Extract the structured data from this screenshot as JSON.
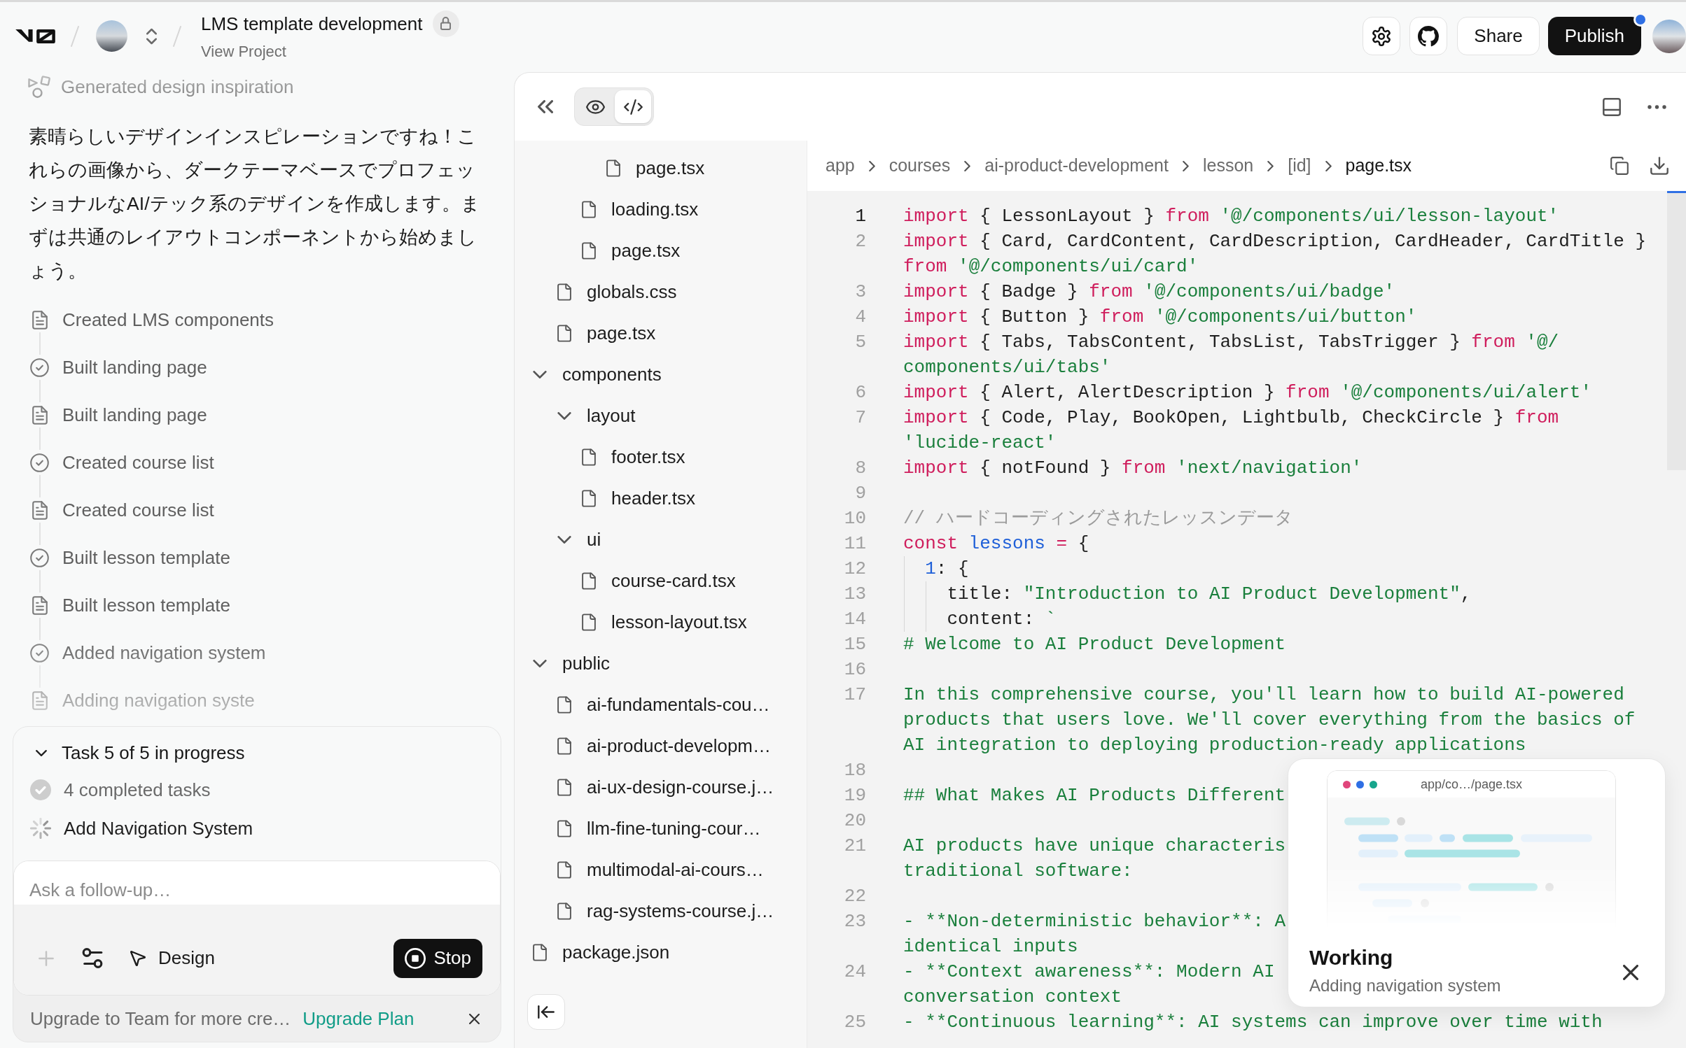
{
  "header": {
    "title": "LMS template development",
    "subtitle": "View Project",
    "buttons": [
      {
        "kind": "secondary",
        "label": "Share",
        "notification": false
      },
      {
        "kind": "primary",
        "label": "Publish",
        "notification": true
      }
    ]
  },
  "chat": {
    "items": [
      {
        "kind": "design",
        "label": "Generated design inspiration"
      },
      {
        "kind": "message",
        "text": "素晴らしいデザインインスピレーションですね！これらの画像から、ダークテーマベースでプロフェッショナルなAI/テック系のデザインを作成します。まずは共通のレイアウトコンポーネントから始めましょう。"
      },
      {
        "kind": "file",
        "label": "Created LMS components"
      },
      {
        "kind": "done",
        "label": "Built landing page"
      },
      {
        "kind": "file",
        "label": "Built landing page"
      },
      {
        "kind": "done",
        "label": "Created course list"
      },
      {
        "kind": "file",
        "label": "Created course list"
      },
      {
        "kind": "done",
        "label": "Built lesson template"
      },
      {
        "kind": "file",
        "label": "Built lesson template"
      },
      {
        "kind": "done",
        "label": "Added navigation system"
      },
      {
        "kind": "file",
        "label": "Adding navigation syste"
      }
    ]
  },
  "task_panel": {
    "title": "Task 5 of 5 in progress",
    "expanded": true,
    "items": [
      {
        "kind": "done",
        "label": "4 completed tasks"
      },
      {
        "kind": "running",
        "label": "Add Navigation System"
      }
    ]
  },
  "composer": {
    "placeholder": "Ask a follow-up…",
    "attach_disabled": true,
    "mode": "Design",
    "stop": "Stop"
  },
  "upgrade_banner": {
    "text": "Upgrade to Team for more cre…",
    "link": "Upgrade Plan"
  },
  "workspace": {
    "view_toggle": [
      {
        "kind": "preview",
        "selected": false
      },
      {
        "kind": "code",
        "selected": true
      }
    ],
    "file_tree": [
      {
        "children": [
          {
            "children": [
              {
                "children": [
                  {
                    "kind": "file",
                    "label": "page.tsx"
                  }
                ]
              },
              {
                "kind": "file",
                "label": "loading.tsx"
              },
              {
                "kind": "file",
                "label": "page.tsx"
              }
            ]
          },
          {
            "kind": "file",
            "label": "globals.css"
          },
          {
            "kind": "file",
            "label": "page.tsx"
          }
        ]
      },
      {
        "kind": "folder",
        "label": "components",
        "expanded": true,
        "children": [
          {
            "kind": "folder",
            "label": "layout",
            "expanded": true,
            "children": [
              {
                "kind": "file",
                "label": "footer.tsx"
              },
              {
                "kind": "file",
                "label": "header.tsx"
              }
            ]
          },
          {
            "kind": "folder",
            "label": "ui",
            "expanded": true,
            "children": [
              {
                "kind": "file",
                "label": "course-card.tsx"
              },
              {
                "kind": "file",
                "label": "lesson-layout.tsx"
              }
            ]
          }
        ]
      },
      {
        "kind": "folder",
        "label": "public",
        "expanded": true,
        "children": [
          {
            "kind": "file",
            "label": "ai-fundamentals-cou…"
          },
          {
            "kind": "file",
            "label": "ai-product-developm…"
          },
          {
            "kind": "file",
            "label": "ai-ux-design-course.j…"
          },
          {
            "kind": "file",
            "label": "llm-fine-tuning-cour…"
          },
          {
            "kind": "file",
            "label": "multimodal-ai-cours…"
          },
          {
            "kind": "file",
            "label": "rag-systems-course.j…"
          }
        ]
      },
      {
        "kind": "file",
        "label": "package.json"
      }
    ],
    "breadcrumb": [
      {
        "label": "app",
        "current": false
      },
      {
        "label": "courses",
        "current": false
      },
      {
        "label": "ai-product-development",
        "current": false
      },
      {
        "label": "lesson",
        "current": false
      },
      {
        "label": "[id]",
        "current": false
      },
      {
        "label": "page.tsx",
        "current": true
      }
    ],
    "code_lines": [
      {
        "number": "1",
        "active": true,
        "rows": [
          [
            {
              "kind": "keyword",
              "text": "import"
            },
            {
              "kind": "plain",
              "text": " { LessonLayout } "
            },
            {
              "kind": "keyword",
              "text": "from"
            },
            {
              "kind": "string",
              "text": " '@/components/ui/lesson-layout'"
            }
          ]
        ]
      },
      {
        "number": "2",
        "active": false,
        "rows": [
          [
            {
              "kind": "keyword",
              "text": "import"
            },
            {
              "kind": "plain",
              "text": " { Card, CardContent, CardDescription, CardHeader, CardTitle }"
            }
          ],
          [
            {
              "kind": "keyword",
              "text": "from"
            },
            {
              "kind": "string",
              "text": " '@/components/ui/card'"
            }
          ]
        ]
      },
      {
        "number": "3",
        "active": false,
        "rows": [
          [
            {
              "kind": "keyword",
              "text": "import"
            },
            {
              "kind": "plain",
              "text": " { Badge } "
            },
            {
              "kind": "keyword",
              "text": "from"
            },
            {
              "kind": "string",
              "text": " '@/components/ui/badge'"
            }
          ]
        ]
      },
      {
        "number": "4",
        "active": false,
        "rows": [
          [
            {
              "kind": "keyword",
              "text": "import"
            },
            {
              "kind": "plain",
              "text": " { Button } "
            },
            {
              "kind": "keyword",
              "text": "from"
            },
            {
              "kind": "string",
              "text": " '@/components/ui/button'"
            }
          ]
        ]
      },
      {
        "number": "5",
        "active": false,
        "rows": [
          [
            {
              "kind": "keyword",
              "text": "import"
            },
            {
              "kind": "plain",
              "text": " { Tabs, TabsContent, TabsList, TabsTrigger } "
            },
            {
              "kind": "keyword",
              "text": "from"
            },
            {
              "kind": "string",
              "text": " '@/"
            }
          ],
          [
            {
              "kind": "string",
              "text": "components/ui/tabs'"
            }
          ]
        ]
      },
      {
        "number": "6",
        "active": false,
        "rows": [
          [
            {
              "kind": "keyword",
              "text": "import"
            },
            {
              "kind": "plain",
              "text": " { Alert, AlertDescription } "
            },
            {
              "kind": "keyword",
              "text": "from"
            },
            {
              "kind": "string",
              "text": " '@/components/ui/alert'"
            }
          ]
        ]
      },
      {
        "number": "7",
        "active": false,
        "rows": [
          [
            {
              "kind": "keyword",
              "text": "import"
            },
            {
              "kind": "plain",
              "text": " { Code, Play, BookOpen, Lightbulb, CheckCircle } "
            },
            {
              "kind": "keyword",
              "text": "from"
            }
          ],
          [
            {
              "kind": "string",
              "text": "'lucide-react'"
            }
          ]
        ]
      },
      {
        "number": "8",
        "active": false,
        "rows": [
          [
            {
              "kind": "keyword",
              "text": "import"
            },
            {
              "kind": "plain",
              "text": " { notFound } "
            },
            {
              "kind": "keyword",
              "text": "from"
            },
            {
              "kind": "string",
              "text": " 'next/navigation'"
            }
          ]
        ]
      },
      {
        "number": "9",
        "active": false
      },
      {
        "number": "10",
        "active": false,
        "rows": [
          [
            {
              "kind": "comment",
              "text": "// ハードコーディングされたレッスンデータ"
            }
          ]
        ]
      },
      {
        "number": "11",
        "active": false,
        "rows": [
          [
            {
              "kind": "keyword",
              "text": "const"
            },
            {
              "kind": "variable",
              "text": " lessons"
            },
            {
              "kind": "keyword",
              "text": " ="
            },
            {
              "kind": "plain",
              "text": " {"
            }
          ]
        ]
      },
      {
        "number": "12",
        "active": false,
        "rows": [
          [
            {
              "kind": "plain",
              "text": "  "
            },
            {
              "kind": "number",
              "text": "1"
            },
            {
              "kind": "plain",
              "text": ": {"
            }
          ]
        ]
      },
      {
        "number": "13",
        "active": false,
        "rows": [
          [
            {
              "kind": "plain",
              "text": "    title: "
            },
            {
              "kind": "string",
              "text": "\"Introduction to AI Product Development\""
            },
            {
              "kind": "plain",
              "text": ","
            }
          ]
        ]
      },
      {
        "number": "14",
        "active": false,
        "rows": [
          [
            {
              "kind": "plain",
              "text": "    content: "
            },
            {
              "kind": "string",
              "text": "`"
            }
          ]
        ]
      },
      {
        "number": "15",
        "active": false,
        "rows": [
          [
            {
              "kind": "string",
              "text": "# Welcome to AI Product Development"
            }
          ]
        ]
      },
      {
        "number": "16",
        "active": false
      },
      {
        "number": "17",
        "active": false,
        "rows": [
          [
            {
              "kind": "string",
              "text": "In this comprehensive course, you'll learn how to build AI-powered"
            }
          ],
          [
            {
              "kind": "string",
              "text": "products that users love. We'll cover everything from the basics of"
            }
          ],
          [
            {
              "kind": "string",
              "text": "AI integration to deploying production-ready applications"
            }
          ]
        ]
      },
      {
        "number": "18",
        "active": false
      },
      {
        "number": "19",
        "active": false,
        "rows": [
          [
            {
              "kind": "string",
              "text": "## What Makes AI Products Different"
            }
          ]
        ]
      },
      {
        "number": "20",
        "active": false
      },
      {
        "number": "21",
        "active": false,
        "rows": [
          [
            {
              "kind": "string",
              "text": "AI products have unique characteris"
            }
          ],
          [
            {
              "kind": "string",
              "text": "traditional software:"
            }
          ]
        ]
      },
      {
        "number": "22",
        "active": false
      },
      {
        "number": "23",
        "active": false,
        "rows": [
          [
            {
              "kind": "string",
              "text": "- **Non-deterministic behavior**: A"
            }
          ],
          [
            {
              "kind": "string",
              "text": "identical inputs"
            }
          ]
        ]
      },
      {
        "number": "24",
        "active": false,
        "rows": [
          [
            {
              "kind": "string",
              "text": "- **Context awareness**: Modern AI"
            }
          ],
          [
            {
              "kind": "string",
              "text": "conversation context"
            }
          ]
        ]
      },
      {
        "number": "25",
        "active": false,
        "rows": [
          [
            {
              "kind": "string",
              "text": "- **Continuous learning**: AI systems can improve over time with"
            }
          ]
        ]
      }
    ]
  },
  "toast": {
    "preview_path": "app/co…/page.tsx",
    "title": "Working",
    "message": "Adding navigation system"
  }
}
